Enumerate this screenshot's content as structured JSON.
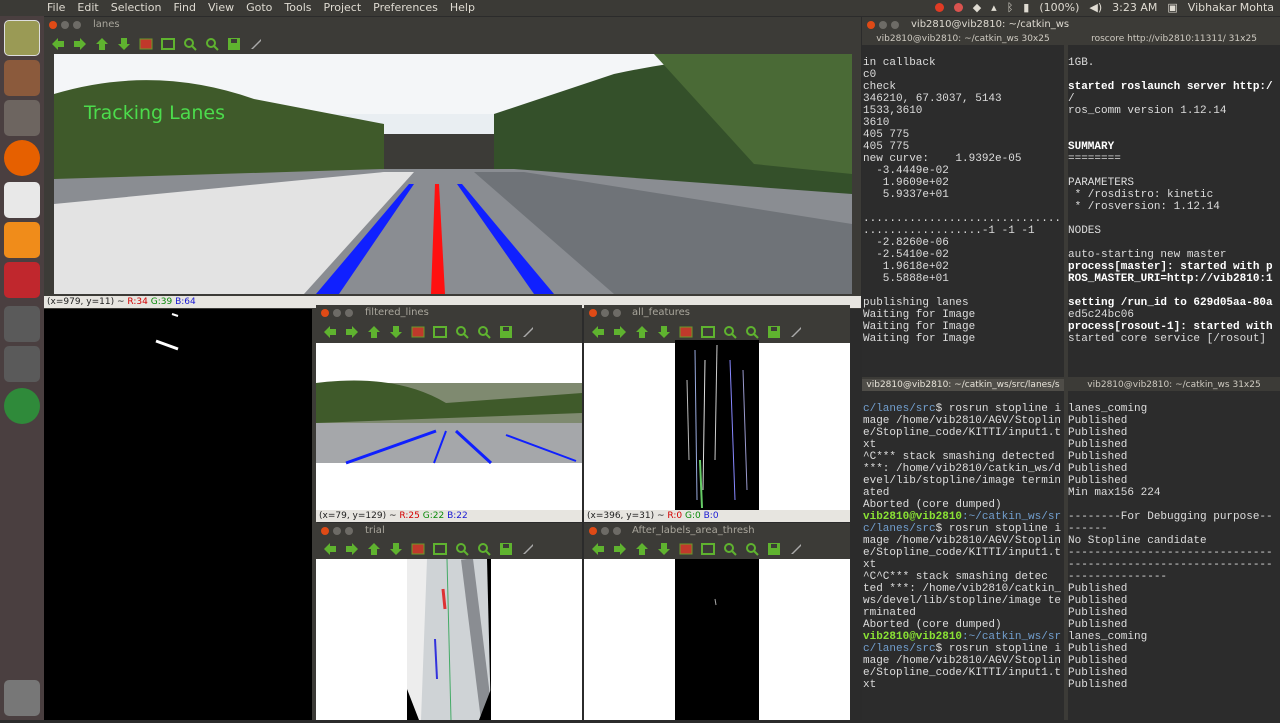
{
  "menubar": {
    "items": [
      "File",
      "Edit",
      "Selection",
      "Find",
      "View",
      "Goto",
      "Tools",
      "Project",
      "Preferences",
      "Help"
    ],
    "battery": "(100%)",
    "time": "3:23 AM",
    "user": "Vibhakar Mohta"
  },
  "windows": {
    "lanes": {
      "title": "lanes",
      "overlay_text": "Tracking Lanes",
      "status": {
        "coords": "(x=979, y=11) ~ ",
        "r": "R:34",
        "g": "G:39",
        "b": "B:64"
      }
    },
    "filtered": {
      "title": "filtered_lines",
      "status": {
        "coords": "(x=79, y=129) ~ ",
        "r": "R:25",
        "g": "G:22",
        "b": "B:22"
      }
    },
    "features": {
      "title": "all_features",
      "status": {
        "coords": "(x=396, y=31) ~ ",
        "r": "R:0",
        "g": "G:0",
        "b": "B:0"
      }
    },
    "trial": {
      "title": "trial"
    },
    "labels": {
      "title": "After_labels_area_thresh"
    }
  },
  "terminal_window": {
    "title": "vib2810@vib2810: ~/catkin_ws"
  },
  "terminals": {
    "t1": {
      "tab": "vib2810@vib2810: ~/catkin_ws 30x25",
      "lines": [
        "in callback",
        "c0",
        "check",
        "346210, 67.3037, 5143",
        "1533,3610",
        "3610",
        "405 775",
        "405 775",
        "new curve:    1.9392e-05",
        "  -3.4449e-02",
        "   1.9609e+02",
        "   5.9337e+01",
        "",
        "..............................",
        "..................-1 -1 -1",
        "  -2.8260e-06",
        "  -2.5410e-02",
        "   1.9618e+02",
        "   5.5888e+01",
        "",
        "publishing lanes",
        "Waiting for Image",
        "Waiting for Image",
        "Waiting for Image"
      ]
    },
    "t2": {
      "tab": "roscore http://vib2810:11311/ 31x25",
      "lines": [
        "1GB.",
        "",
        "started roslaunch server http:/",
        "/",
        "ros_comm version 1.12.14",
        "",
        "",
        "SUMMARY",
        "========",
        "",
        "PARAMETERS",
        " * /rosdistro: kinetic",
        " * /rosversion: 1.12.14",
        "",
        "NODES",
        "",
        "auto-starting new master",
        "process[master]: started with p",
        "ROS_MASTER_URI=http://vib2810:1",
        "",
        "setting /run_id to 629d05aa-80a",
        "ed5c24bc06",
        "process[rosout-1]: started with",
        "started core service [/rosout]"
      ]
    },
    "t3": {
      "tab": "vib2810@vib2810: ~/catkin_ws/src/lanes/s",
      "lines": [
        {
          "pre": "c/lanes/src",
          "mid": "$ rosrun stopline i"
        },
        {
          "text": "mage /home/vib2810/AGV/Stoplin"
        },
        {
          "text": "e/Stopline_code/KITTI/input1.t"
        },
        {
          "text": "xt"
        },
        {
          "text": "^C*** stack smashing detected"
        },
        {
          "text": "***: /home/vib2810/catkin_ws/d"
        },
        {
          "text": "evel/lib/stopline/image termin"
        },
        {
          "text": "ated"
        },
        {
          "text": "Aborted (core dumped)"
        },
        {
          "user": "vib2810@vib2810",
          "path": ":~/catkin_ws/sr"
        },
        {
          "pre": "c/lanes/src",
          "mid": "$ rosrun stopline i"
        },
        {
          "text": "mage /home/vib2810/AGV/Stoplin"
        },
        {
          "text": "e/Stopline_code/KITTI/input1.t"
        },
        {
          "text": "xt"
        },
        {
          "text": "^C^C*** stack smashing detec"
        },
        {
          "text": "ted ***: /home/vib2810/catkin_"
        },
        {
          "text": "ws/devel/lib/stopline/image te"
        },
        {
          "text": "rminated"
        },
        {
          "text": "Aborted (core dumped)"
        },
        {
          "user": "vib2810@vib2810",
          "path": ":~/catkin_ws/sr"
        },
        {
          "pre": "c/lanes/src",
          "mid": "$ rosrun stopline i"
        },
        {
          "text": "mage /home/vib2810/AGV/Stoplin"
        },
        {
          "text": "e/Stopline_code/KITTI/input1.t"
        },
        {
          "text": "xt"
        }
      ]
    },
    "t4": {
      "tab": "vib2810@vib2810: ~/catkin_ws 31x25",
      "lines": [
        "lanes_coming",
        "Published",
        "Published",
        "Published",
        "Published",
        "Published",
        "Published",
        "Min max156 224",
        "",
        "--------For Debugging purpose--",
        "------",
        "No Stopline candidate",
        "-------------------------------",
        "-------------------------------",
        "---------------",
        "Published",
        "Published",
        "Published",
        "Published",
        "lanes_coming",
        "Published",
        "Published",
        "Published",
        "Published"
      ]
    }
  }
}
